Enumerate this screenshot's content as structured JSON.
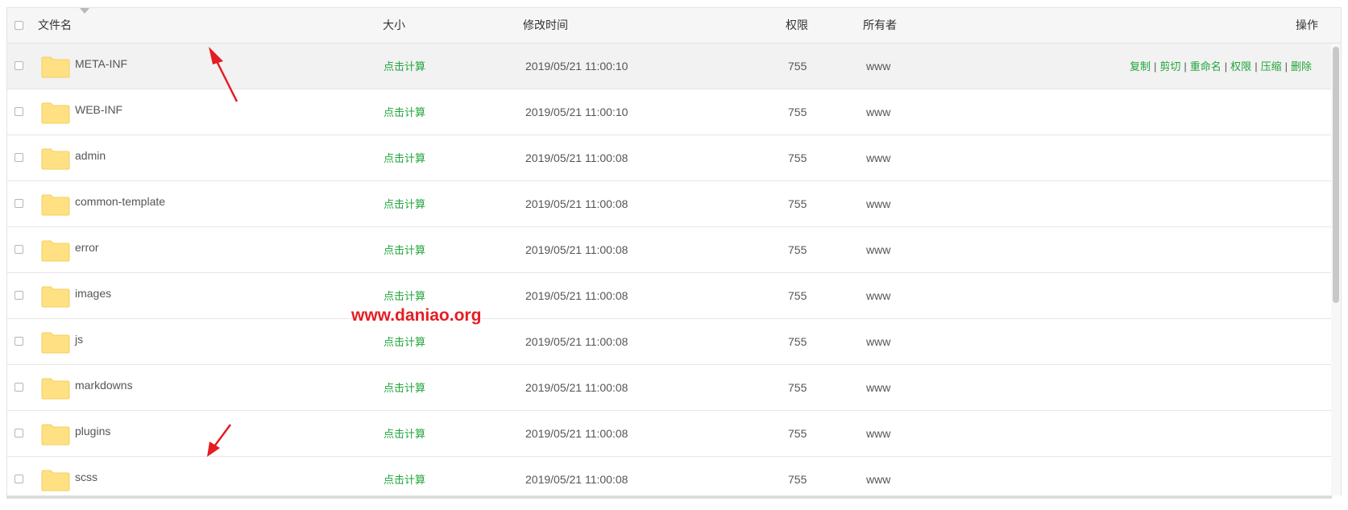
{
  "header": {
    "name": "文件名",
    "size": "大小",
    "mtime": "修改时间",
    "perm": "权限",
    "owner": "所有者",
    "ops": "操作"
  },
  "rows": [
    {
      "name": "META-INF",
      "size": "点击计算",
      "mtime": "2019/05/21 11:00:10",
      "perm": "755",
      "owner": "www"
    },
    {
      "name": "WEB-INF",
      "size": "点击计算",
      "mtime": "2019/05/21 11:00:10",
      "perm": "755",
      "owner": "www"
    },
    {
      "name": "admin",
      "size": "点击计算",
      "mtime": "2019/05/21 11:00:08",
      "perm": "755",
      "owner": "www"
    },
    {
      "name": "common-template",
      "size": "点击计算",
      "mtime": "2019/05/21 11:00:08",
      "perm": "755",
      "owner": "www"
    },
    {
      "name": "error",
      "size": "点击计算",
      "mtime": "2019/05/21 11:00:08",
      "perm": "755",
      "owner": "www"
    },
    {
      "name": "images",
      "size": "点击计算",
      "mtime": "2019/05/21 11:00:08",
      "perm": "755",
      "owner": "www"
    },
    {
      "name": "js",
      "size": "点击计算",
      "mtime": "2019/05/21 11:00:08",
      "perm": "755",
      "owner": "www"
    },
    {
      "name": "markdowns",
      "size": "点击计算",
      "mtime": "2019/05/21 11:00:08",
      "perm": "755",
      "owner": "www"
    },
    {
      "name": "plugins",
      "size": "点击计算",
      "mtime": "2019/05/21 11:00:08",
      "perm": "755",
      "owner": "www"
    },
    {
      "name": "scss",
      "size": "点击计算",
      "mtime": "2019/05/21 11:00:08",
      "perm": "755",
      "owner": "www"
    }
  ],
  "row_actions": {
    "copy": "复制",
    "cut": "剪切",
    "rename": "重命名",
    "perm": "权限",
    "compress": "压缩",
    "delete": "删除",
    "separator": "|"
  },
  "watermark": "www.daniao.org",
  "colors": {
    "link_green": "#20a53a",
    "folder": "#ffe083",
    "arrow": "#e51c23"
  }
}
